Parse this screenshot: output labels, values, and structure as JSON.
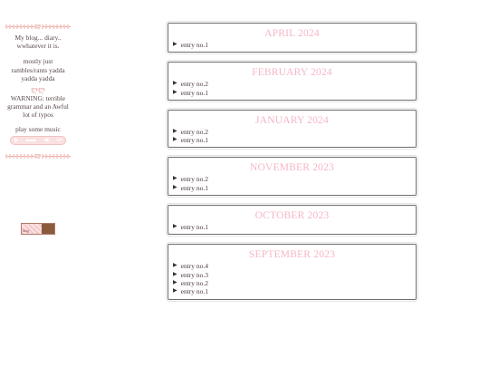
{
  "sidebar": {
    "intro": "My blog... diary.. wwhatever it is.",
    "about": "mostly just rambles/rants yadda yadda yadda",
    "bow": "ღღ",
    "warning": "WARNING: terrible grammar and an Awful lot of typos",
    "music_label": "play some music",
    "player": {
      "play": "▶",
      "vol": "◀)",
      "skip": "⏭"
    },
    "badge_text": "blog"
  },
  "archive": [
    {
      "month": "APRIL 2024",
      "entries": [
        "entry no.1"
      ]
    },
    {
      "month": "FEBRUARY 2024",
      "entries": [
        "entry no.2",
        "entry no.1"
      ]
    },
    {
      "month": "JANUARY 2024",
      "entries": [
        "entry no.2",
        "entry no.1"
      ]
    },
    {
      "month": "NOVEMBER 2023",
      "entries": [
        "entry no.2",
        "entry no.1"
      ]
    },
    {
      "month": "OCTOBER 2023",
      "entries": [
        "entry no.1"
      ]
    },
    {
      "month": "SEPTEMBER 2023",
      "entries": [
        "entry no.4",
        "entry no.3",
        "entry no.2",
        "entry no.1"
      ]
    }
  ],
  "colors": {
    "month_title": "#f6b6c4",
    "divider": "#e8a7a4"
  },
  "icons": {
    "entry_marker": "triangle-right-icon",
    "divider_bow": "bow-icon"
  }
}
